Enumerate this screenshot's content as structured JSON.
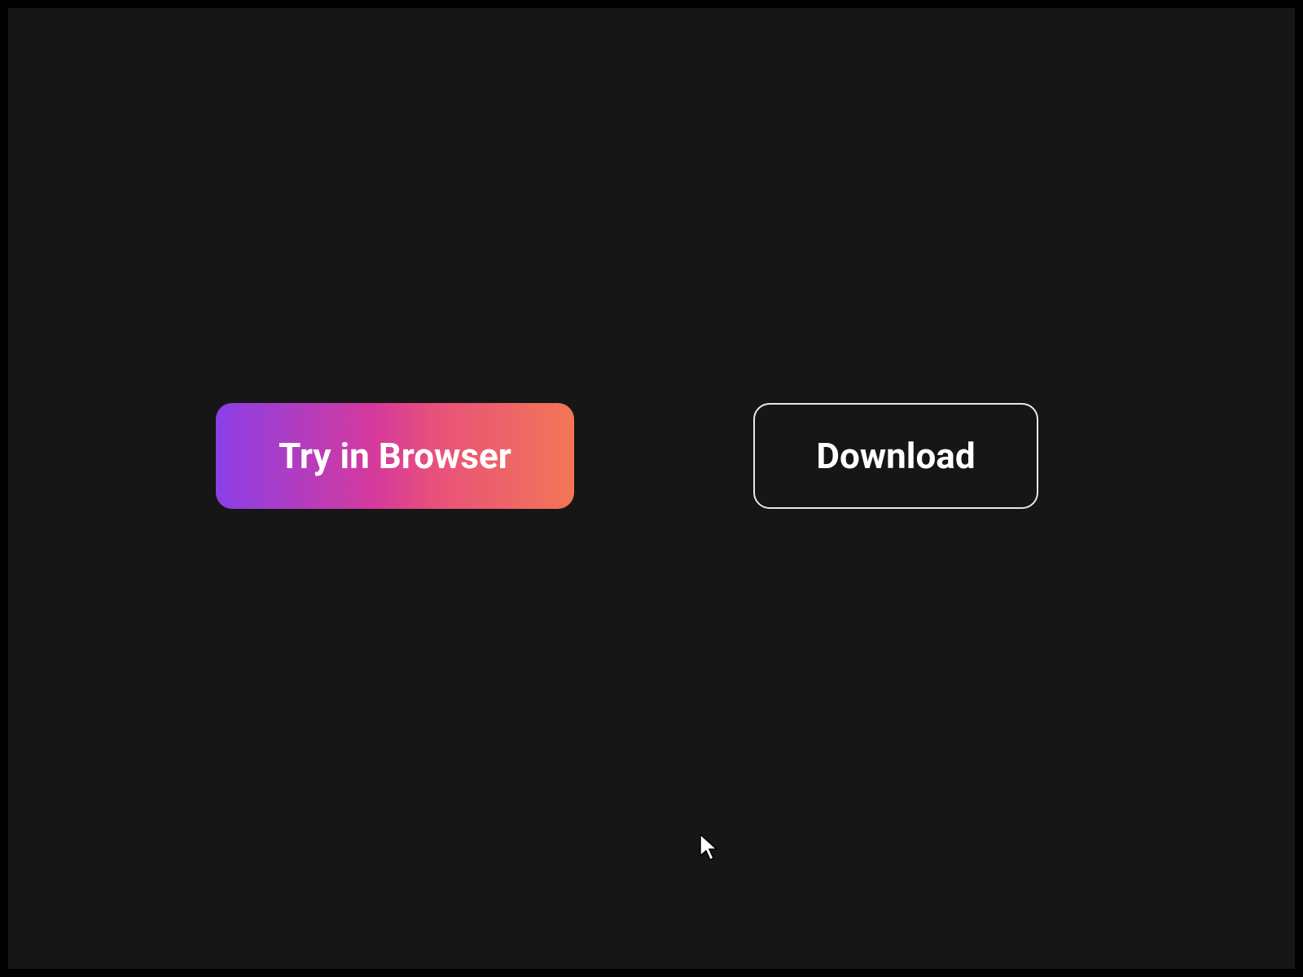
{
  "buttons": {
    "primary_label": "Try in Browser",
    "secondary_label": "Download"
  }
}
